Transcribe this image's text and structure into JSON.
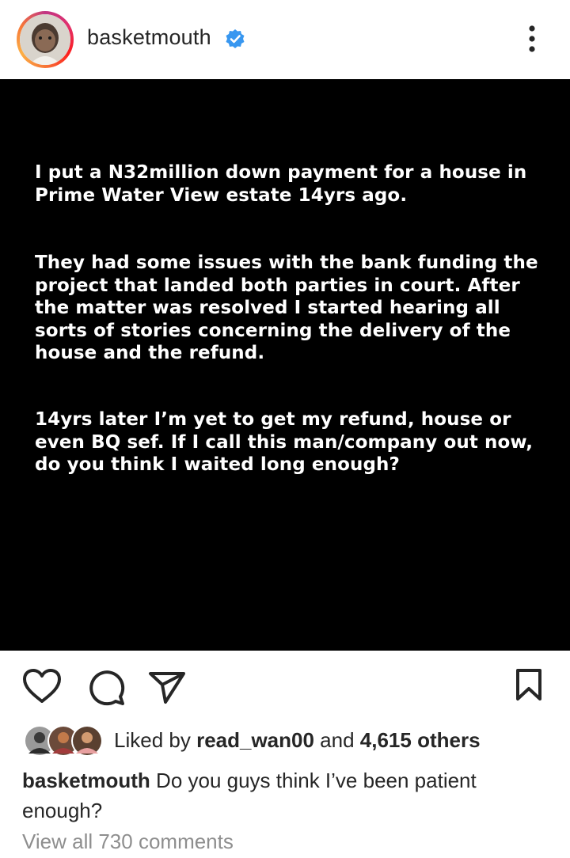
{
  "header": {
    "username": "basketmouth",
    "verified_icon": "verified-badge-icon",
    "more_icon": "more-options-icon"
  },
  "post": {
    "paragraphs": [
      "I put a N32million down payment for a house in Prime Water View estate 14yrs ago.",
      "They had some issues with the bank funding the project that landed both parties in court. After the matter was resolved I started hearing all sorts of stories concerning the delivery of the house and the refund.",
      "14yrs later I’m yet to get my refund, house or even BQ sef. If I call this man/company out now, do you think I waited long enough?"
    ]
  },
  "actions": {
    "like_icon": "heart-icon",
    "comment_icon": "comment-icon",
    "share_icon": "share-icon",
    "save_icon": "bookmark-icon"
  },
  "likes": {
    "prefix": "Liked by ",
    "user": "read_wan00",
    "middle": " and ",
    "count": "4,615 others"
  },
  "caption": {
    "username": "basketmouth",
    "text": " Do you guys think I’ve been patient enough?"
  },
  "comments": {
    "link": "View all 730 comments"
  },
  "colors": {
    "verified": "#3897f0",
    "text": "#262626",
    "muted": "#8e8e8e",
    "post_bg": "#000000"
  }
}
